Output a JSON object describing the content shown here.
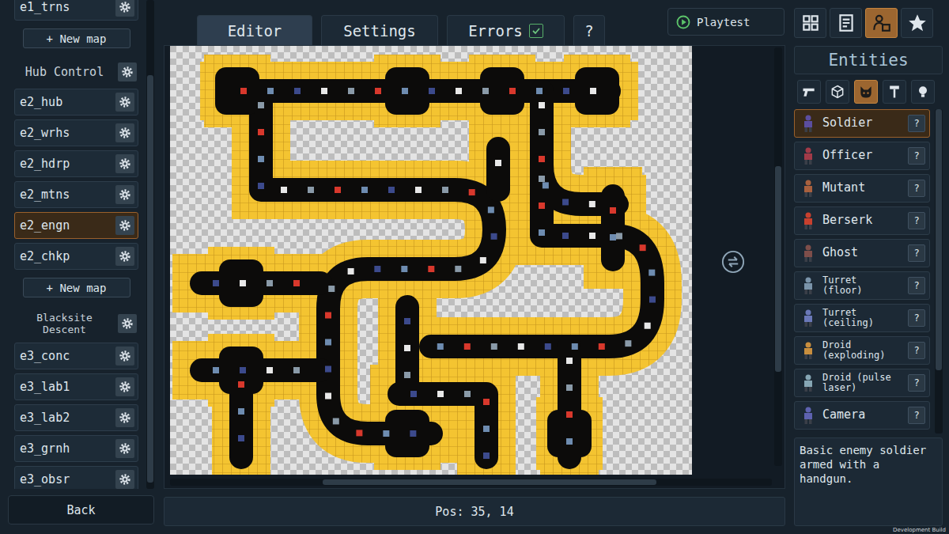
{
  "sidebar": {
    "items": [
      {
        "label": "e1_trns",
        "kind": "map",
        "selected": false
      },
      {
        "label": "+ New map",
        "kind": "new"
      },
      {
        "label": "Hub Control",
        "kind": "group"
      },
      {
        "label": "e2_hub",
        "kind": "map",
        "selected": false
      },
      {
        "label": "e2_wrhs",
        "kind": "map",
        "selected": false
      },
      {
        "label": "e2_hdrp",
        "kind": "map",
        "selected": false
      },
      {
        "label": "e2_mtns",
        "kind": "map",
        "selected": false
      },
      {
        "label": "e2_engn",
        "kind": "map",
        "selected": true
      },
      {
        "label": "e2_chkp",
        "kind": "map",
        "selected": false
      },
      {
        "label": "+ New map",
        "kind": "new"
      },
      {
        "label": "Blacksite Descent",
        "kind": "group"
      },
      {
        "label": "e3_conc",
        "kind": "map",
        "selected": false
      },
      {
        "label": "e3_lab1",
        "kind": "map",
        "selected": false
      },
      {
        "label": "e3_lab2",
        "kind": "map",
        "selected": false
      },
      {
        "label": "e3_grnh",
        "kind": "map",
        "selected": false
      },
      {
        "label": "e3_obsr",
        "kind": "map",
        "selected": false
      }
    ],
    "back": "Back"
  },
  "tabs": [
    {
      "label": "Editor",
      "selected": true
    },
    {
      "label": "Settings",
      "selected": false
    },
    {
      "label": "Errors",
      "selected": false,
      "checked": true
    },
    {
      "label": "?",
      "selected": false
    }
  ],
  "playtest": {
    "label": "Playtest"
  },
  "mode_buttons": [
    {
      "selected": false
    },
    {
      "selected": false
    },
    {
      "selected": true
    },
    {
      "selected": false
    }
  ],
  "entities_panel": {
    "title": "Entities",
    "categories": [
      {
        "selected": false
      },
      {
        "selected": false
      },
      {
        "selected": true
      },
      {
        "selected": false
      },
      {
        "selected": false
      }
    ],
    "items": [
      {
        "label": "Soldier",
        "help": "?",
        "selected": true,
        "color": "#5b4ea0"
      },
      {
        "label": "Officer",
        "help": "?",
        "selected": false,
        "color": "#a23a48"
      },
      {
        "label": "Mutant",
        "help": "?",
        "selected": false,
        "color": "#a8603e"
      },
      {
        "label": "Berserk",
        "help": "?",
        "selected": false,
        "color": "#c8402e"
      },
      {
        "label": "Ghost",
        "help": "?",
        "selected": false,
        "color": "#7e4e4a"
      },
      {
        "label": "Turret\n(floor)",
        "help": "?",
        "selected": false,
        "color": "#7a94aa"
      },
      {
        "label": "Turret\n(ceiling)",
        "help": "?",
        "selected": false,
        "color": "#6a78b8"
      },
      {
        "label": "Droid\n(exploding)",
        "help": "?",
        "selected": false,
        "color": "#c88e3e"
      },
      {
        "label": "Droid (pulse\nlaser)",
        "help": "?",
        "selected": false,
        "color": "#86a6b4"
      },
      {
        "label": "Camera",
        "help": "?",
        "selected": false,
        "color": "#5e62b0"
      }
    ],
    "description": "Basic enemy soldier armed with a handgun."
  },
  "status_bar": {
    "position": "Pos: 35, 14"
  },
  "build_label": "Development Build"
}
